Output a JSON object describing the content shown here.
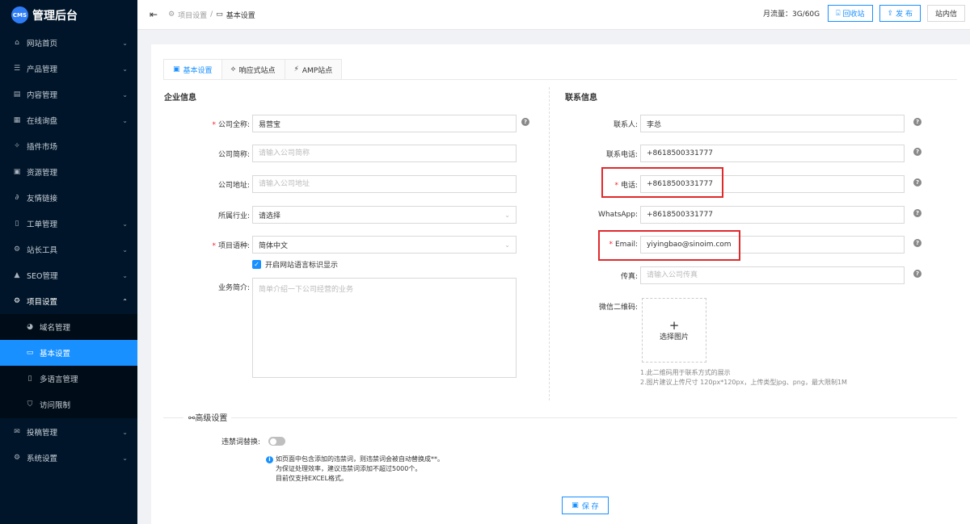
{
  "brand": {
    "logo": "CMS",
    "title": "管理后台"
  },
  "sidebar": {
    "items": [
      {
        "label": "网站首页",
        "icon": "home-icon"
      },
      {
        "label": "产品管理",
        "icon": "list-icon"
      },
      {
        "label": "内容管理",
        "icon": "doc-icon"
      },
      {
        "label": "在线询盘",
        "icon": "grid-icon"
      },
      {
        "label": "插件市场",
        "icon": "pin-icon"
      },
      {
        "label": "资源管理",
        "icon": "apps-icon"
      },
      {
        "label": "友情链接",
        "icon": "link-icon"
      },
      {
        "label": "工单管理",
        "icon": "file-icon"
      },
      {
        "label": "站长工具",
        "icon": "tools-icon"
      },
      {
        "label": "SEO管理",
        "icon": "warning-icon"
      },
      {
        "label": "项目设置",
        "icon": "gear-icon"
      },
      {
        "label": "投稿管理",
        "icon": "mail-icon"
      },
      {
        "label": "系统设置",
        "icon": "gear-icon"
      }
    ],
    "sub": [
      {
        "label": "域名管理",
        "icon": "globe-icon"
      },
      {
        "label": "基本设置",
        "icon": "window-icon"
      },
      {
        "label": "多语言管理",
        "icon": "doc-icon"
      },
      {
        "label": "访问限制",
        "icon": "shield-icon"
      }
    ]
  },
  "header": {
    "breadcrumb": [
      "项目设置",
      "基本设置"
    ],
    "separator": "/",
    "traffic": "月流量：3G/60G",
    "recycle": "回收站",
    "publish": "发 布",
    "messages": "站内信"
  },
  "tabs": [
    "基本设置",
    "响应式站点",
    "AMP站点"
  ],
  "company": {
    "title": "企业信息",
    "full_name_label": "公司全称:",
    "full_name_value": "易营宝",
    "short_name_label": "公司简称:",
    "short_name_placeholder": "请输入公司简称",
    "address_label": "公司地址:",
    "address_placeholder": "请输入公司地址",
    "industry_label": "所属行业:",
    "industry_value": "请选择",
    "language_label": "项目语种:",
    "language_value": "简体中文",
    "lang_flag_label": "开启网站语言标识显示",
    "intro_label": "业务简介:",
    "intro_placeholder": "简单介绍一下公司经营的业务"
  },
  "contact": {
    "title": "联系信息",
    "person_label": "联系人:",
    "person_value": "李总",
    "phone_label": "联系电话:",
    "phone_value": "+8618500331777",
    "tel_label": "电话:",
    "tel_value": "+8618500331777",
    "whatsapp_label": "WhatsApp:",
    "whatsapp_value": "+8618500331777",
    "email_label": "Email:",
    "email_value": "yiyingbao@sinoim.com",
    "fax_label": "传真:",
    "fax_placeholder": "请输入公司传真",
    "qr_label": "微信二维码:",
    "qr_plus": "+",
    "qr_select": "选择图片",
    "qr_note1": "1.此二维码用于联系方式的展示",
    "qr_note2": "2.图片建议上传尺寸 120px*120px，上传类型jpg、png，最大限制1M"
  },
  "advanced": {
    "title": "高级设置",
    "filter_label": "违禁词替换:",
    "info1": "如页面中包含添加的违禁词，则违禁词会被自动替换成**。",
    "info2": "为保证处理效率，建议违禁词添加不超过5000个。",
    "info3": "目前仅支持EXCEL格式。",
    "save": "保 存"
  },
  "colors": {
    "primary": "#1890ff",
    "sidebar": "#001529",
    "highlight": "#e0292b"
  }
}
